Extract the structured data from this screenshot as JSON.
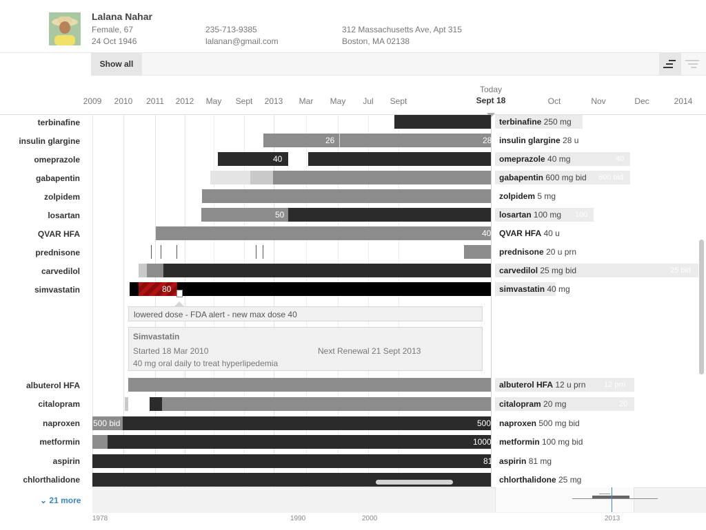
{
  "patient": {
    "name": "Lalana Nahar",
    "gender_age": "Female, 67",
    "dob": "24 Oct 1946",
    "phone": "235-713-9385",
    "email": "lalanan@gmail.com",
    "address_line1": "312 Massachusetts Ave, Apt 315",
    "address_line2": "Boston, MA 02138"
  },
  "toolbar": {
    "show_all": "Show all"
  },
  "timeline": {
    "ticks": [
      "2009",
      "2010",
      "2011",
      "2012",
      "May",
      "Sept",
      "2013",
      "Mar",
      "May",
      "Jul",
      "Sept",
      "Oct",
      "Nov",
      "Dec",
      "2014"
    ],
    "today_label": "Today",
    "today_date": "Sept 18"
  },
  "medications": [
    {
      "name": "terbinafine",
      "label_bold": "terbinafine",
      "label_rest": " 250 mg",
      "bar_values": []
    },
    {
      "name": "insulin glargine",
      "label_bold": "insulin glargine",
      "label_rest": " 28 u",
      "bar_values": [
        "26",
        "28"
      ]
    },
    {
      "name": "omeprazole",
      "label_bold": "omeprazole",
      "label_rest": " 40 mg",
      "bar_values": [
        "40"
      ],
      "ghost": "40"
    },
    {
      "name": "gabapentin",
      "label_bold": "gabapentin",
      "label_rest": " 600 mg bid",
      "bar_values": [],
      "ghost": "600 bid"
    },
    {
      "name": "zolpidem",
      "label_bold": "zolpidem",
      "label_rest": " 5 mg",
      "bar_values": []
    },
    {
      "name": "losartan",
      "label_bold": "losartan",
      "label_rest": " 100 mg",
      "bar_values": [
        "50"
      ],
      "ghost": "100"
    },
    {
      "name": "QVAR HFA",
      "label_bold": "QVAR HFA",
      "label_rest": " 40 u",
      "bar_values": [
        "40"
      ]
    },
    {
      "name": "prednisone",
      "label_bold": "prednisone",
      "label_rest": " 20 u prn",
      "bar_values": []
    },
    {
      "name": "carvedilol",
      "label_bold": "carvedilol",
      "label_rest": "  25 mg bid",
      "bar_values": [],
      "ghost": "25 bid"
    },
    {
      "name": "simvastatin",
      "label_bold": "simvastatin",
      "label_rest": " 40 mg",
      "bar_values": [
        "80"
      ]
    },
    {
      "name": "albuterol HFA",
      "label_bold": "albuterol HFA",
      "label_rest": " 12 u prn",
      "bar_values": [],
      "ghost": "12 prn"
    },
    {
      "name": "citalopram",
      "label_bold": "citalopram",
      "label_rest": " 20 mg",
      "bar_values": [],
      "ghost": "20"
    },
    {
      "name": "naproxen",
      "label_bold": "naproxen",
      "label_rest": "  500 mg bid",
      "bar_values": [
        "500 bid",
        "500"
      ]
    },
    {
      "name": "metformin",
      "label_bold": "metformin",
      "label_rest": " 100 mg bid",
      "bar_values": [
        "1000"
      ]
    },
    {
      "name": "aspirin",
      "label_bold": "aspirin",
      "label_rest": " 81 mg",
      "bar_values": [
        "81"
      ]
    },
    {
      "name": "chlorthalidone",
      "label_bold": "chlorthalidone",
      "label_rest": " 25 mg",
      "bar_values": []
    }
  ],
  "selected_detail": {
    "note": "lowered dose - FDA alert - new max dose 40",
    "title": "Simvastatin",
    "started": "Started 18 Mar 2010",
    "renewal": "Next Renewal 21 Sept 2013",
    "description": "40 mg oral daily to treat hyperlipedemia"
  },
  "more_link": "21 more",
  "overview_ticks": [
    "1978",
    "1990",
    "2000",
    "2013"
  ],
  "colors": {
    "bar_dark": "#2b2b2b",
    "bar_mid": "#8c8c8c",
    "bar_light": "#c9c9c9",
    "bar_pale": "#e4e4e4",
    "alert_red": "#b11212",
    "link_blue": "#3a86c8"
  }
}
